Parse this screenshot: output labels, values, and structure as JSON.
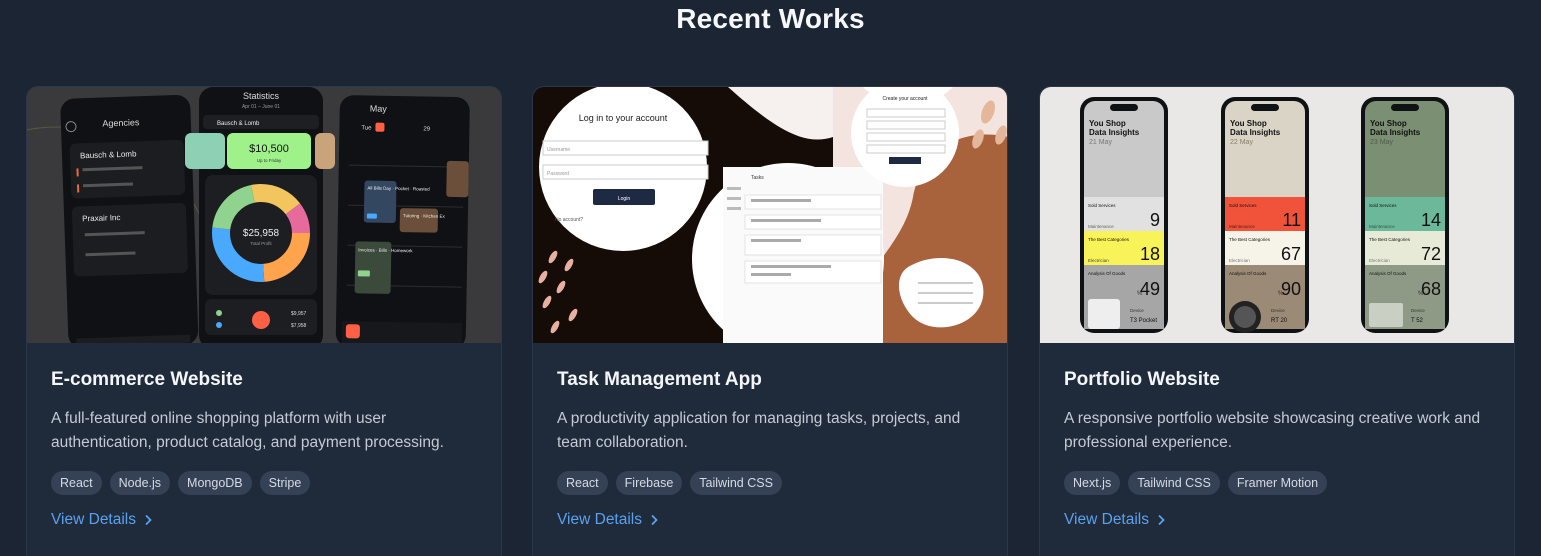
{
  "section": {
    "title": "Recent Works"
  },
  "thumb1": {
    "agencies": "Agencies",
    "statistics": "Statistics",
    "daterange": "Apr 01 – June 01",
    "client1": "Bausch & Lomb",
    "client2": "Praxair Inc",
    "amount_card": "$10,500",
    "amount_sub": "Up to Friday",
    "donut_total": "$25,958",
    "donut_sub": "Total Profit",
    "month": "May",
    "row_a": "Tue",
    "row_b": "29",
    "tile_a": "All Bills Day · Pocket · Roasted",
    "tile_b": "Tutoring · Kitchen Ex",
    "tile_c": "Invoices · Bills · Homework",
    "badge1": "8/200",
    "badge2": "7/200",
    "amount_row": "$7,958",
    "amount_row2": "$9,957"
  },
  "thumb2": {
    "login_title": "Log in to your account",
    "username_ph": "Username",
    "password_ph": "Password",
    "login_btn": "Login",
    "no_account": "No account?",
    "create_title": "Create your account",
    "tasks_label": "Tasks"
  },
  "thumb3": {
    "phones": [
      {
        "brand": "You Shop",
        "subtitle": "Data Insights",
        "date": "21 May",
        "v1": "9",
        "v2": "18",
        "v3": "49",
        "model": "T3 Pocket"
      },
      {
        "brand": "You Shop",
        "subtitle": "Data Insights",
        "date": "22 May",
        "v1": "11",
        "v2": "67",
        "v3": "90",
        "model": "RT 20"
      },
      {
        "brand": "You Shop",
        "subtitle": "Data Insights",
        "date": "23 May",
        "v1": "14",
        "v2": "72",
        "v3": "68",
        "model": "T 52"
      }
    ],
    "label_sold": "Sold Services",
    "label_best": "The Best Categories",
    "label_analysis": "Analysis Of Goods",
    "label_maint": "Maintenance",
    "label_elec": "Electrician",
    "label_device": "Device",
    "label_pct": "%"
  },
  "projects": [
    {
      "title": "E-commerce Website",
      "description": "A full-featured online shopping platform with user authentication, product catalog, and payment processing.",
      "tags": [
        "React",
        "Node.js",
        "MongoDB",
        "Stripe"
      ],
      "link": "View Details"
    },
    {
      "title": "Task Management App",
      "description": "A productivity application for managing tasks, projects, and team collaboration.",
      "tags": [
        "React",
        "Firebase",
        "Tailwind CSS"
      ],
      "link": "View Details"
    },
    {
      "title": "Portfolio Website",
      "description": "A responsive portfolio website showcasing creative work and professional experience.",
      "tags": [
        "Next.js",
        "Tailwind CSS",
        "Framer Motion"
      ],
      "link": "View Details"
    }
  ],
  "colors": {
    "background": "#1b2533",
    "card": "#1f2a3a",
    "link": "#5aa2ee",
    "tag_bg": "#354155"
  }
}
